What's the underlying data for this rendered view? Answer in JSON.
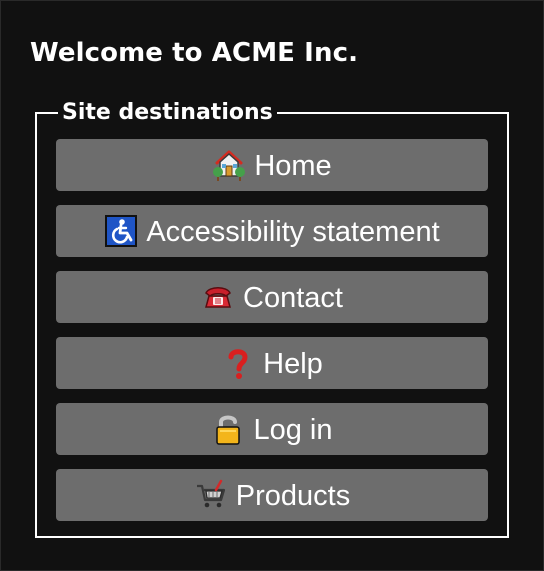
{
  "page": {
    "title": "Welcome to ACME Inc."
  },
  "site_destinations": {
    "legend": "Site destinations",
    "buttons": [
      {
        "label": "Home",
        "icon": "house-icon"
      },
      {
        "label": "Accessibility statement",
        "icon": "wheelchair-icon"
      },
      {
        "label": "Contact",
        "icon": "telephone-icon"
      },
      {
        "label": "Help",
        "icon": "question-mark-icon"
      },
      {
        "label": "Log in",
        "icon": "lock-icon"
      },
      {
        "label": "Products",
        "icon": "shopping-cart-icon"
      }
    ]
  },
  "colors": {
    "background": "#111111",
    "button_background": "#6d6d6d",
    "text": "#ffffff",
    "border": "#ffffff"
  }
}
